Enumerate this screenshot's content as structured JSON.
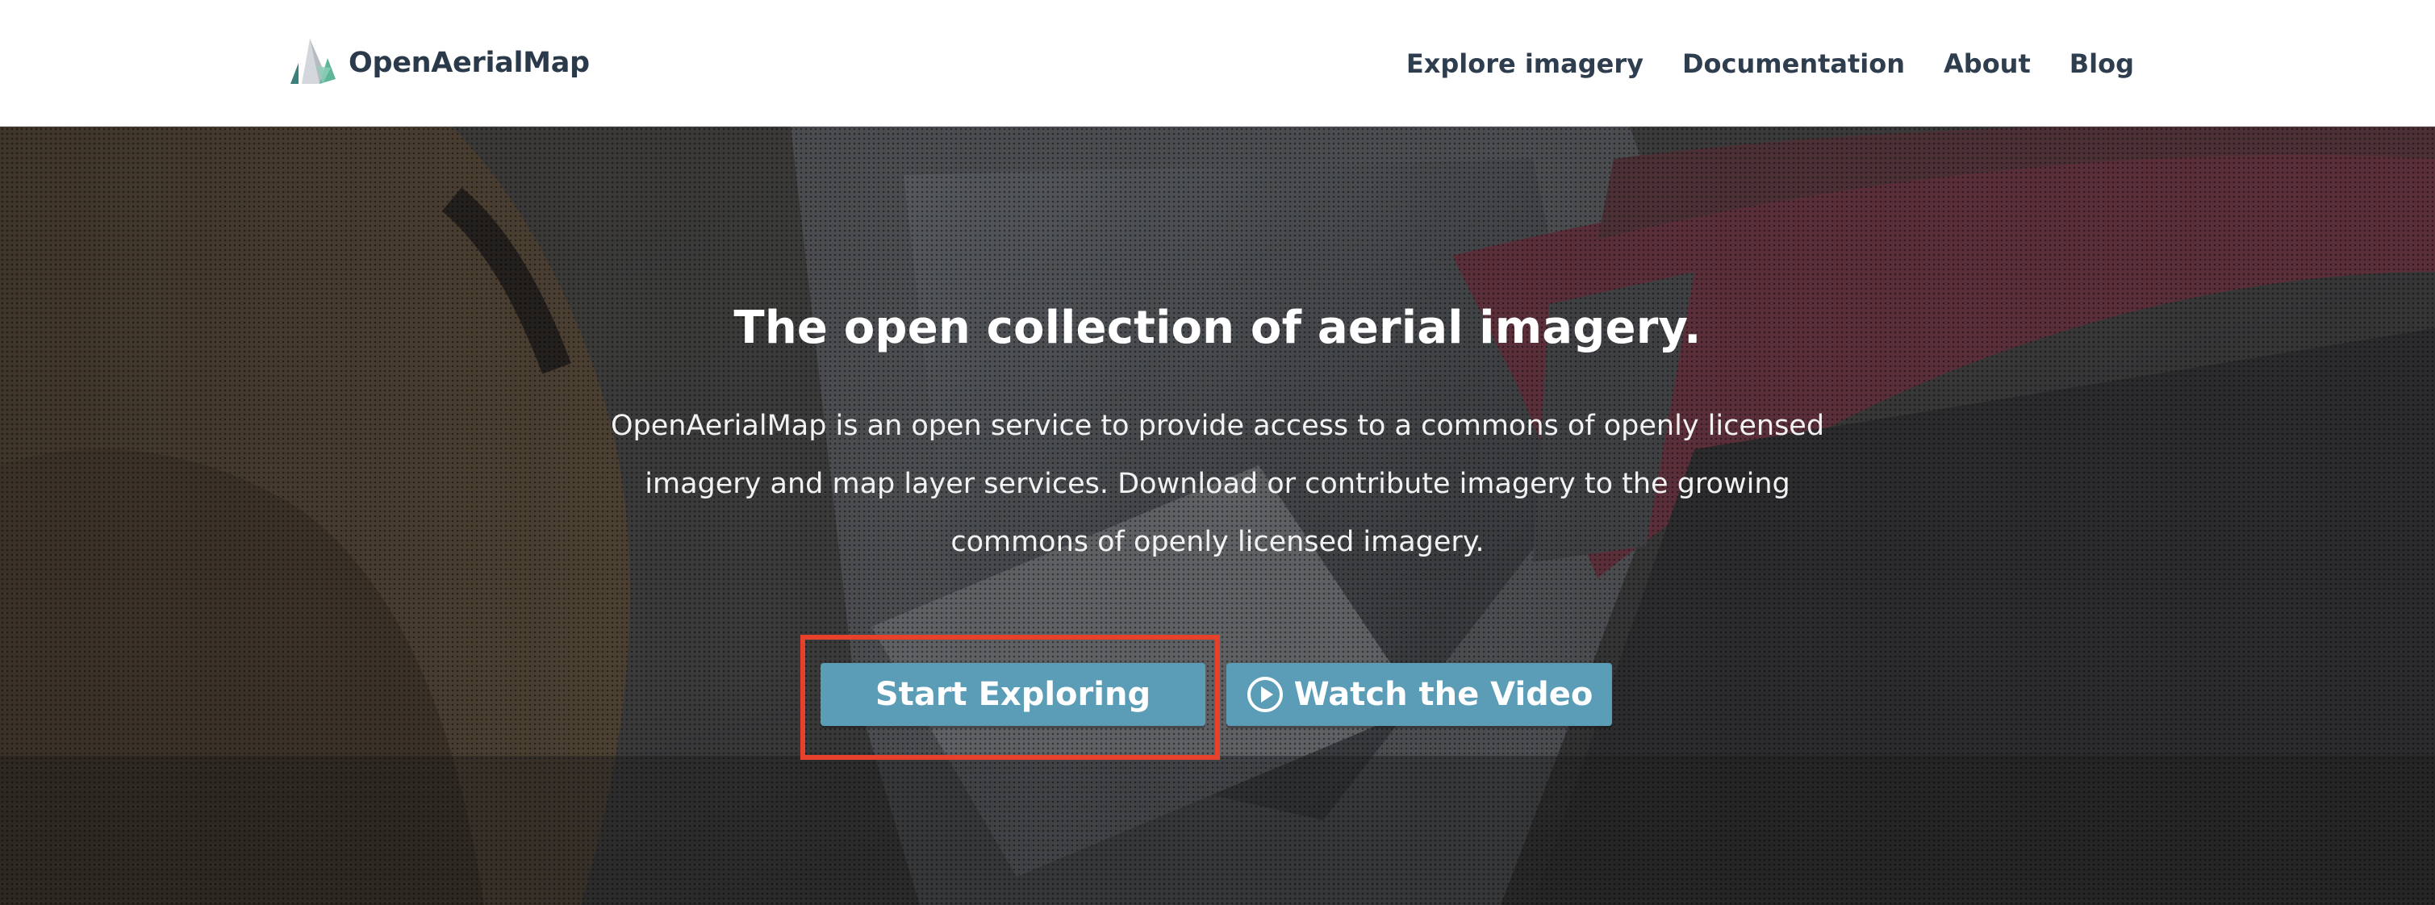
{
  "header": {
    "brand_name": "OpenAerialMap",
    "brand_icon": "openaerialmap-logo-icon",
    "nav": [
      {
        "label": "Explore imagery"
      },
      {
        "label": "Documentation"
      },
      {
        "label": "About"
      },
      {
        "label": "Blog"
      }
    ]
  },
  "hero": {
    "title": "The open collection of aerial imagery.",
    "lede": "OpenAerialMap is an open service to provide access to a commons of openly licensed imagery and map layer services. Download or contribute imagery to the growing commons of openly licensed imagery.",
    "primary_cta": "Start Exploring",
    "secondary_cta": "Watch the Video",
    "secondary_cta_icon": "play-circle-icon"
  },
  "colors": {
    "button": "#5b9cb7",
    "nav_text": "#2f3e4f",
    "highlight": "#e8412b"
  }
}
